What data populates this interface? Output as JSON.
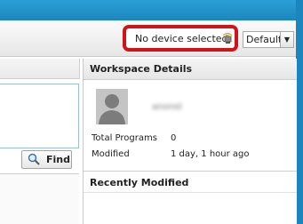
{
  "toolbar": {
    "device_status": "No device selected",
    "device_icon": "device-signal-icon",
    "profile_dropdown": {
      "value": "Default"
    }
  },
  "left_pane": {
    "find_button": {
      "label": "Find",
      "icon": "magnifier-icon"
    }
  },
  "workspace_details": {
    "title": "Workspace Details",
    "user": {
      "name": "anonst",
      "avatar_icon": "user-silhouette-icon"
    },
    "rows": [
      {
        "label": "Total Programs",
        "value": "0"
      },
      {
        "label": "Modified",
        "value": "1 day, 1 hour ago"
      }
    ]
  },
  "recently_modified": {
    "title": "Recently Modified"
  },
  "colors": {
    "titlebar": "#1b86bd",
    "highlight": "#d0121b",
    "panel_border": "#9bbbd6"
  }
}
